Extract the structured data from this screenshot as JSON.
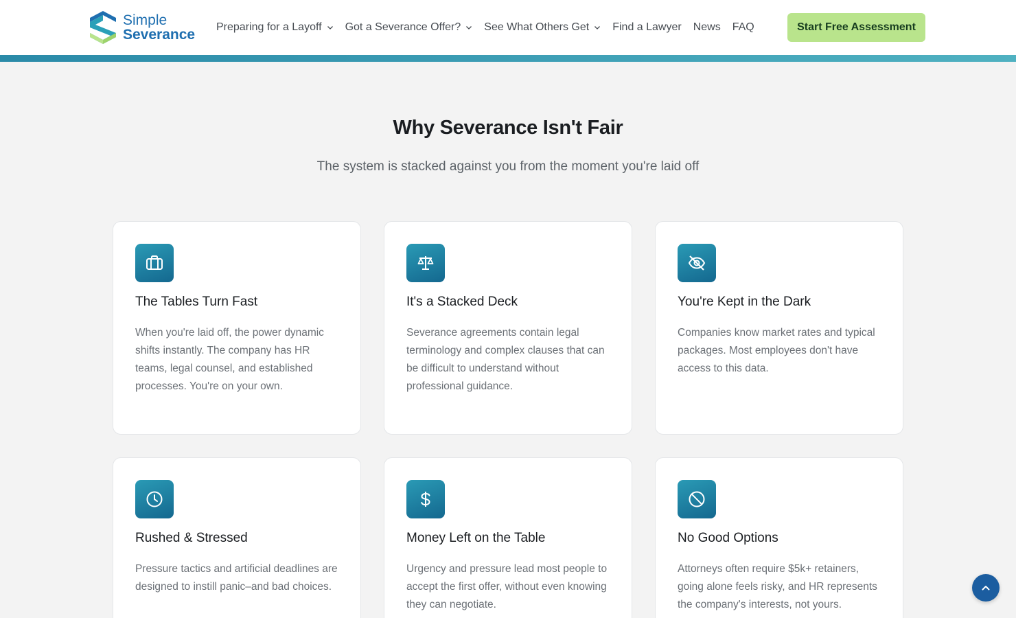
{
  "brand": {
    "line1": "Simple",
    "line2": "Severance"
  },
  "nav": {
    "items": [
      {
        "label": "Preparing for a Layoff",
        "dropdown": true
      },
      {
        "label": "Got a Severance Offer?",
        "dropdown": true
      },
      {
        "label": "See What Others Get",
        "dropdown": true
      },
      {
        "label": "Find a Lawyer",
        "dropdown": false
      },
      {
        "label": "News",
        "dropdown": false
      },
      {
        "label": "FAQ",
        "dropdown": false
      }
    ],
    "cta": "Start Free Assessment"
  },
  "section": {
    "title": "Why Severance Isn't Fair",
    "subtitle": "The system is stacked against you from the moment you're laid off"
  },
  "cards": [
    {
      "icon": "briefcase-icon",
      "title": "The Tables Turn Fast",
      "body": "When you're laid off, the power dynamic shifts instantly. The company has HR teams, legal counsel, and established processes. You're on your own."
    },
    {
      "icon": "scale-icon",
      "title": "It's a Stacked Deck",
      "body": "Severance agreements contain legal terminology and complex clauses that can be difficult to understand without professional guidance."
    },
    {
      "icon": "eye-off-icon",
      "title": "You're Kept in the Dark",
      "body": "Companies know market rates and typical packages. Most employees don't have access to this data."
    },
    {
      "icon": "clock-icon",
      "title": "Rushed & Stressed",
      "body": "Pressure tactics and artificial deadlines are designed to instill panic–and bad choices."
    },
    {
      "icon": "dollar-icon",
      "title": "Money Left on the Table",
      "body": "Urgency and pressure lead most people to accept the first offer, without even knowing they can negotiate."
    },
    {
      "icon": "ban-icon",
      "title": "No Good Options",
      "body": "Attorneys often require $5k+ retainers, going alone feels risky, and HR represents the company's interests, not yours."
    }
  ],
  "colors": {
    "accent": "#1f6fb0",
    "cta": "#b9e48c",
    "icon_bg": "#1a7fa3",
    "fab": "#1b5da0"
  }
}
